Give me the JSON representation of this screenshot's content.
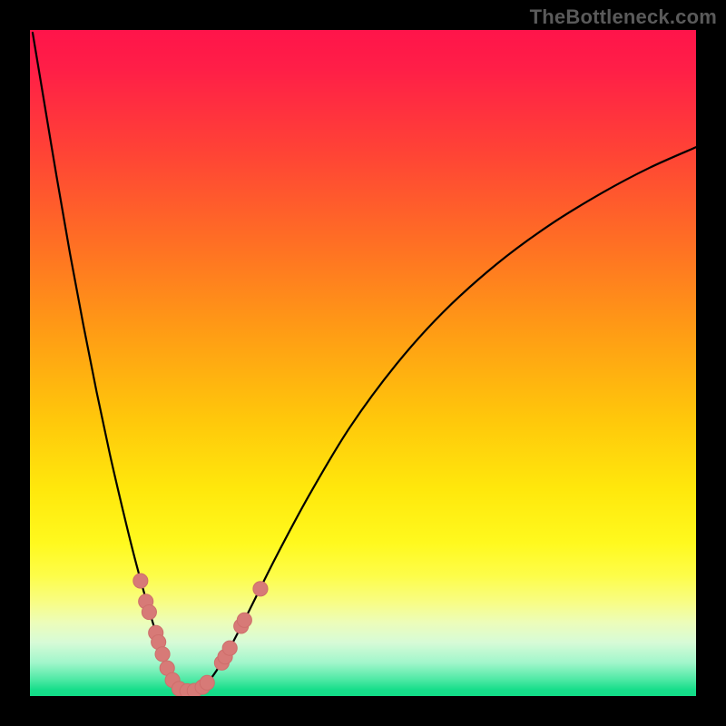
{
  "watermark": "TheBottleneck.com",
  "colors": {
    "frame": "#000000",
    "curve": "#000000",
    "dot_fill": "#d77a77",
    "dot_stroke": "#ce6e6b"
  },
  "chart_data": {
    "type": "line",
    "title": "",
    "xlabel": "",
    "ylabel": "",
    "xlim": [
      0,
      100
    ],
    "ylim": [
      0,
      100
    ],
    "grid": false,
    "series": [
      {
        "name": "left-branch",
        "x": [
          0.4,
          2,
          4,
          6,
          8,
          10,
          12,
          14,
          15.5,
          17,
          18.3,
          19.3,
          20.1,
          20.7,
          21.3,
          21.9,
          22.4
        ],
        "y": [
          99.6,
          90,
          78,
          66.5,
          55.8,
          45.7,
          36.3,
          27.7,
          21.6,
          16,
          11.5,
          8.3,
          5.9,
          4.1,
          2.8,
          1.8,
          1.2
        ]
      },
      {
        "name": "valley",
        "x": [
          22.4,
          22.9,
          23.4,
          23.9,
          24.4,
          24.9,
          25.4,
          25.9
        ],
        "y": [
          1.2,
          0.9,
          0.75,
          0.7,
          0.72,
          0.85,
          1.05,
          1.35
        ]
      },
      {
        "name": "right-branch",
        "x": [
          25.9,
          26.8,
          28,
          30,
          33,
          37,
          42,
          48,
          55,
          62,
          70,
          78,
          86,
          93,
          100
        ],
        "y": [
          1.35,
          2.2,
          3.8,
          7.2,
          13,
          21,
          30.3,
          40.3,
          49.8,
          57.6,
          64.8,
          70.7,
          75.6,
          79.3,
          82.4
        ]
      }
    ],
    "markers": {
      "name": "highlighted-points",
      "color": "#d77a77",
      "points": [
        {
          "x": 16.6,
          "y": 17.3,
          "r": 1.1
        },
        {
          "x": 17.4,
          "y": 14.2,
          "r": 1.1
        },
        {
          "x": 17.9,
          "y": 12.6,
          "r": 1.1
        },
        {
          "x": 18.9,
          "y": 9.5,
          "r": 1.1
        },
        {
          "x": 19.3,
          "y": 8.1,
          "r": 1.1
        },
        {
          "x": 19.9,
          "y": 6.3,
          "r": 1.1
        },
        {
          "x": 20.6,
          "y": 4.2,
          "r": 1.1
        },
        {
          "x": 21.4,
          "y": 2.4,
          "r": 1.1
        },
        {
          "x": 22.4,
          "y": 1.1,
          "r": 1.1
        },
        {
          "x": 23.6,
          "y": 0.75,
          "r": 1.1
        },
        {
          "x": 24.7,
          "y": 0.8,
          "r": 1.1
        },
        {
          "x": 25.9,
          "y": 1.35,
          "r": 1.1
        },
        {
          "x": 26.6,
          "y": 2.0,
          "r": 1.1
        },
        {
          "x": 28.8,
          "y": 5.0,
          "r": 1.1
        },
        {
          "x": 29.3,
          "y": 5.9,
          "r": 1.1
        },
        {
          "x": 30.0,
          "y": 7.2,
          "r": 1.1
        },
        {
          "x": 31.7,
          "y": 10.5,
          "r": 1.1
        },
        {
          "x": 32.2,
          "y": 11.4,
          "r": 1.1
        },
        {
          "x": 34.6,
          "y": 16.1,
          "r": 1.1
        }
      ]
    }
  }
}
